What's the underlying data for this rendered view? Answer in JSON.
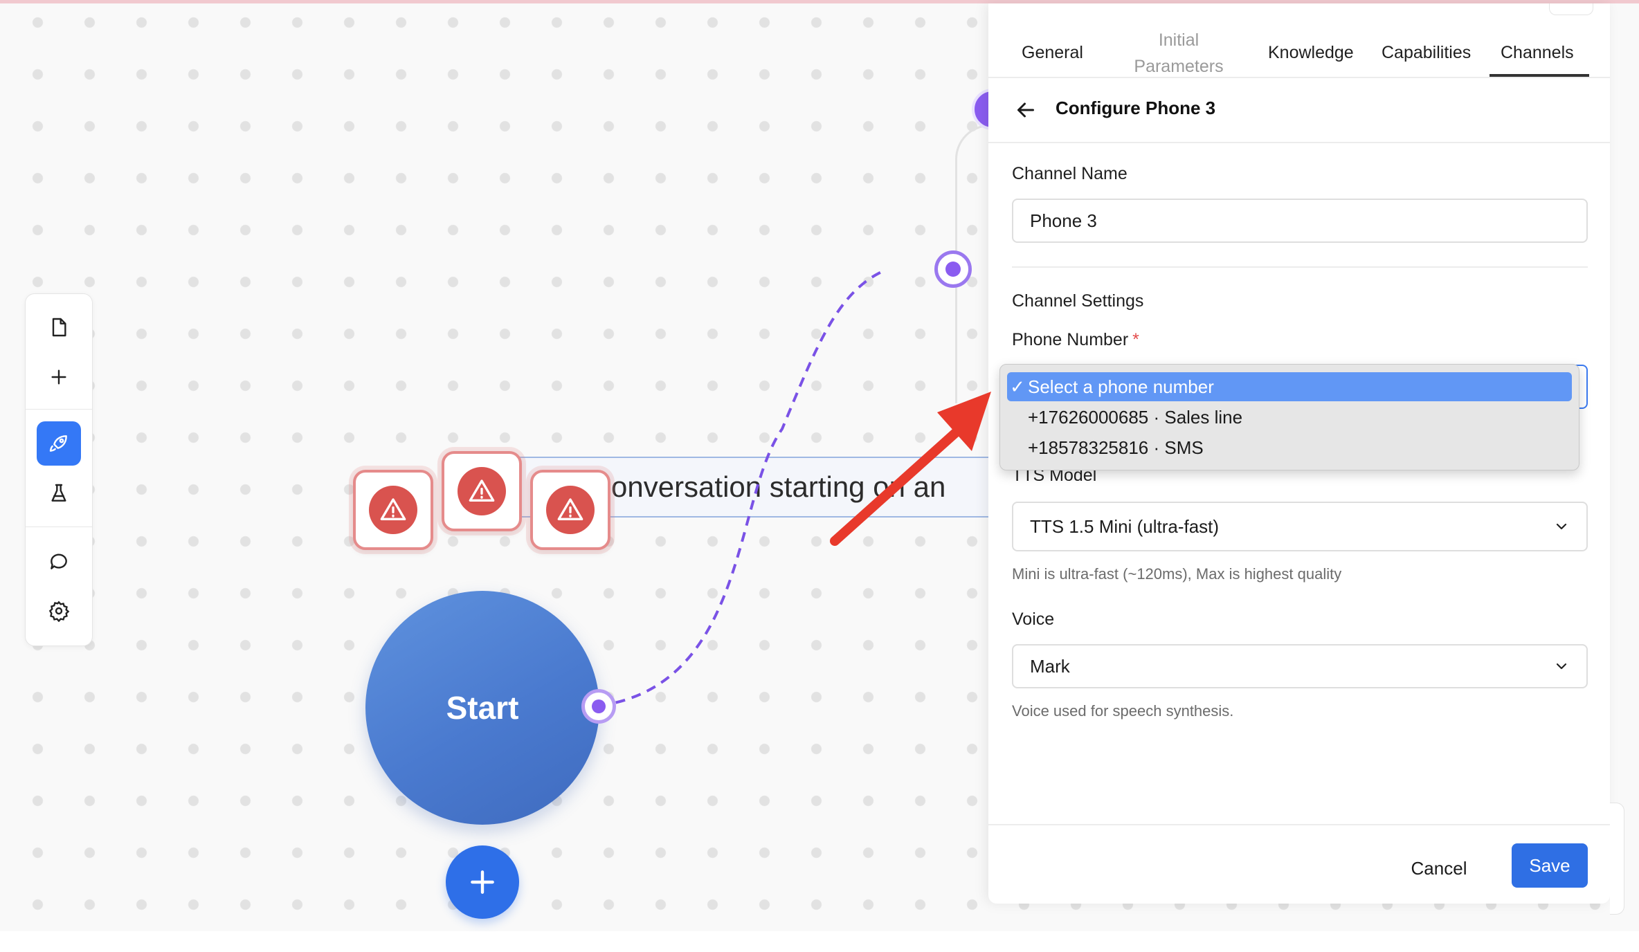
{
  "canvas": {
    "start_label": "Start",
    "banner_text": "conversation starting on an"
  },
  "toolbar": {
    "items": [
      "file-icon",
      "plus-icon",
      "rocket-icon",
      "flask-icon",
      "chat-icon",
      "gear-icon"
    ]
  },
  "panel": {
    "tabs": {
      "general": "General",
      "initial_parameters_line1": "Initial",
      "initial_parameters_line2": "Parameters",
      "knowledge": "Knowledge",
      "capabilities": "Capabilities",
      "channels": "Channels"
    },
    "title": "Configure Phone 3",
    "channel_name_label": "Channel Name",
    "channel_name_value": "Phone 3",
    "channel_settings_label": "Channel Settings",
    "phone_number_label": "Phone Number",
    "required_mark": "*",
    "phone_number_options": [
      {
        "check": "✓",
        "label": "Select a phone number"
      },
      {
        "check": "",
        "label": "+17626000685 · Sales line"
      },
      {
        "check": "",
        "label": "+18578325816 · SMS"
      }
    ],
    "tts_model_label": "TTS Model",
    "tts_model_value": "TTS 1.5 Mini (ultra-fast)",
    "tts_model_hint": "Mini is ultra-fast (~120ms), Max is highest quality",
    "voice_label": "Voice",
    "voice_value": "Mark",
    "voice_hint": "Voice used for speech synthesis.",
    "cancel_label": "Cancel",
    "save_label": "Save"
  },
  "colors": {
    "accent": "#2f6fe4",
    "handle": "#8a5cf0",
    "warning": "#d9534f",
    "annotation_arrow": "#e8392b"
  }
}
